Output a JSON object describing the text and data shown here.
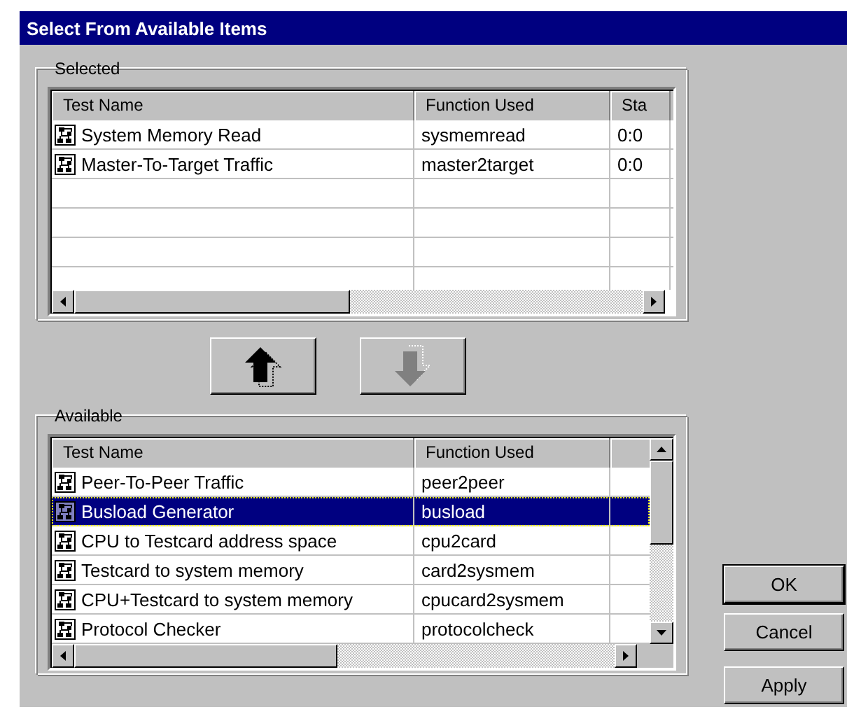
{
  "window": {
    "title": "Select From Available Items"
  },
  "selected_group": {
    "label": "Selected",
    "columns": [
      "Test Name",
      "Function Used",
      "Sta"
    ],
    "rows": [
      {
        "cells": [
          "System Memory Read",
          "sysmemread",
          "0:0"
        ]
      },
      {
        "cells": [
          "Master-To-Target Traffic",
          "master2target",
          "0:0"
        ]
      }
    ]
  },
  "move_buttons": [
    {
      "kind": "up",
      "disabled": false
    },
    {
      "kind": "down",
      "disabled": true
    }
  ],
  "available_group": {
    "label": "Available",
    "columns": [
      "Test Name",
      "Function Used"
    ],
    "rows": [
      {
        "cells": [
          "Peer-To-Peer Traffic",
          "peer2peer"
        ],
        "selected": false
      },
      {
        "cells": [
          "Busload Generator",
          "busload"
        ],
        "selected": true
      },
      {
        "cells": [
          "CPU to Testcard address space",
          "cpu2card"
        ],
        "selected": false
      },
      {
        "cells": [
          "Testcard to system memory",
          "card2sysmem"
        ],
        "selected": false
      },
      {
        "cells": [
          "CPU+Testcard to system memory",
          "cpucard2sysmem"
        ],
        "selected": false
      },
      {
        "cells": [
          "Protocol Checker",
          "protocolcheck"
        ],
        "selected": false
      }
    ]
  },
  "buttons": [
    {
      "label": "OK",
      "default": true
    },
    {
      "label": "Cancel",
      "default": false
    },
    {
      "label": "Apply",
      "default": false
    }
  ]
}
